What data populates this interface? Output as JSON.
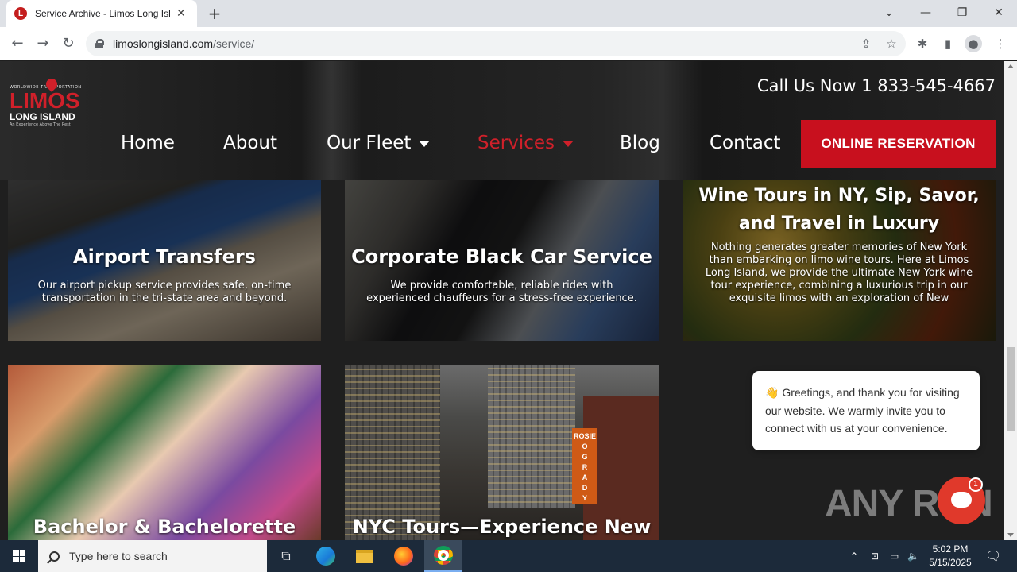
{
  "browser": {
    "tab_title": "Service Archive - Limos Long Isl",
    "tab_favicon": "L",
    "url_domain": "limoslongisland.com",
    "url_path": "/service/"
  },
  "site": {
    "logo_top": "WORLDWIDE TRANSPORTATION",
    "logo_main": "LIMOS",
    "logo_sub": "LONG ISLAND",
    "logo_tag": "An Experience Above The Rest",
    "call": "Call Us Now 1 833-545-4667",
    "nav": {
      "home": "Home",
      "about": "About",
      "fleet": "Our Fleet",
      "services": "Services",
      "blog": "Blog",
      "contact": "Contact"
    },
    "reserve": "ONLINE RESERVATION",
    "accent": "#c8101e"
  },
  "cards": [
    {
      "title": "Airport Transfers",
      "desc": "Our airport pickup service provides safe, on-time transportation in the tri-state area and beyond."
    },
    {
      "title": "Corporate Black Car Service",
      "desc": "We provide comfortable, reliable rides with experienced chauffeurs for a stress-free experience."
    },
    {
      "title": "Wine Tours in NY, Sip, Savor, and Travel in Luxury",
      "desc": "Nothing generates greater memories of New York than embarking on limo wine tours. Here at Limos Long Island, we provide the ultimate New York wine tour experience, combining a luxurious trip in our exquisite limos with an exploration of New"
    },
    {
      "title": "Bachelor & Bachelorette Party",
      "desc": ""
    },
    {
      "title": "NYC Tours—Experience New York",
      "desc": ""
    }
  ],
  "chat": {
    "message": "👋 Greetings, and thank you for visiting our website. We warmly invite you to connect with us at your convenience.",
    "badge": "1"
  },
  "watermark": "ANY RUN",
  "taskbar": {
    "search_placeholder": "Type here to search",
    "time": "5:02 PM",
    "date": "5/15/2025"
  }
}
